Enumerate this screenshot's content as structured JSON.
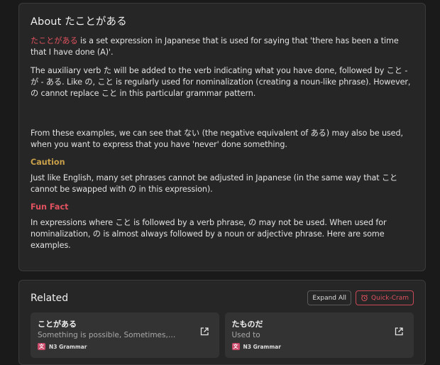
{
  "about": {
    "title": "About たことがある",
    "term": "たことがある",
    "intro_rest": " is a set expression in Japanese that is used for saying that 'there has been a time that I have done (A)'.",
    "para2": "The auxiliary verb た will be added to the verb indicating what you have done, followed by こと - が - ある. Like の, こと is regularly used for nominalization (creating a noun-like phrase). However, の cannot replace こと in this particular grammar pattern.",
    "para3": "From these examples, we can see that ない (the negative equivalent of ある) may also be used, when you want to express that you have 'never' done something.",
    "caution_label": "Caution",
    "caution_text": "Just like English, many set phrases cannot be adjusted in Japanese (in the same way that こと cannot be swapped with の in this expression).",
    "funfact_label": "Fun Fact",
    "funfact_text": "In expressions where こと is followed by a verb phrase, の may not be used. When used for nominalization, の is almost always followed by a noun or adjective phrase. Here are some examples."
  },
  "related": {
    "title": "Related",
    "expand_label": "Expand All",
    "cram_label": "Quick-Cram",
    "items": [
      {
        "title": "ことがある",
        "meaning": "Something is possible, Sometimes,…",
        "tag": "N3 Grammar"
      },
      {
        "title": "たものだ",
        "meaning": "Used to",
        "tag": "N3 Grammar"
      }
    ]
  },
  "colors": {
    "accent": "#e0525f",
    "caution": "#c9a04a",
    "background": "#1a1a1a",
    "card": "#262626"
  }
}
